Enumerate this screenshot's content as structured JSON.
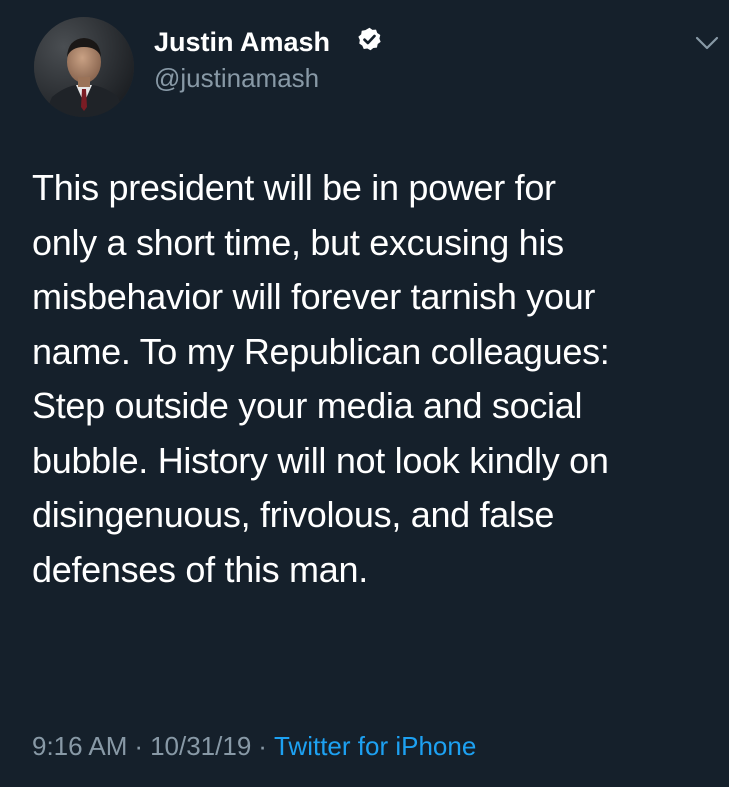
{
  "tweet": {
    "author": {
      "name": "Justin Amash",
      "handle": "@justinamash",
      "verified": true,
      "avatar_icon": "profile-photo"
    },
    "text_lines": [
      "This president will be in power for",
      "only a short time, but excusing his",
      "misbehavior will forever tarnish your",
      "name. To my Republican colleagues:",
      "Step outside your media and social",
      "bubble. History will not look kindly on",
      "disingenuous, frivolous, and false",
      "defenses of this man."
    ],
    "time": "9:16 AM",
    "date": "10/31/19",
    "separator": "·",
    "source": "Twitter for iPhone",
    "menu_icon": "chevron-down-icon"
  },
  "colors": {
    "background": "#15202b",
    "text": "#ffffff",
    "secondary_text": "#8899a6",
    "link": "#1da1f2",
    "verified_badge": "#ffffff"
  }
}
